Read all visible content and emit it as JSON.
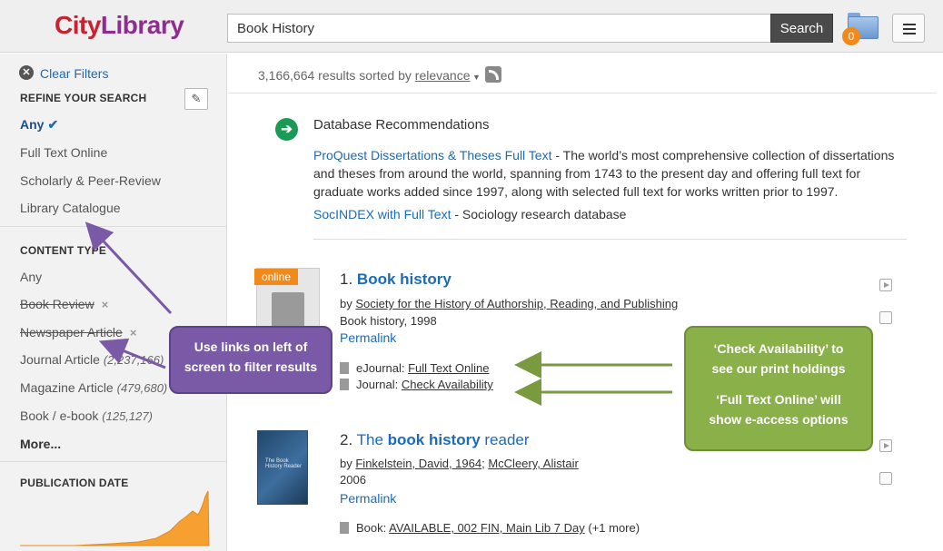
{
  "header": {
    "logo_part1": "City",
    "logo_part2": "Library",
    "search_value": "Book History",
    "search_button": "Search",
    "folder_count": "0"
  },
  "sidebar": {
    "clear_filters": "Clear Filters",
    "refine_heading": "REFINE YOUR SEARCH",
    "refine_items": [
      "Any",
      "Full Text Online",
      "Scholarly & Peer-Review",
      "Library Catalogue"
    ],
    "content_type_heading": "CONTENT TYPE",
    "content_items": [
      {
        "label": "Any",
        "count": ""
      },
      {
        "label": "Book Review",
        "count": ""
      },
      {
        "label": "Newspaper Article",
        "count": ""
      },
      {
        "label": "Journal Article",
        "count": "(2,237,166)"
      },
      {
        "label": "Magazine Article",
        "count": "(479,680)"
      },
      {
        "label": "Book / e-book",
        "count": "(125,127)"
      }
    ],
    "more_label": "More...",
    "publication_date_heading": "PUBLICATION DATE"
  },
  "results": {
    "count_text": "3,166,664 results sorted by",
    "sort_value": "relevance",
    "recommendations": {
      "title": "Database Recommendations",
      "items": [
        {
          "link": "ProQuest Dissertations & Theses Full Text",
          "description": " - The world’s most comprehensive collection of dissertations and theses from around the world, spanning from 1743 to the present day and offering full text for graduate works added since 1997, along with selected full text for works written prior to 1997."
        },
        {
          "link": "SocINDEX with Full Text",
          "description": " - Sociology research database"
        }
      ]
    },
    "items": [
      {
        "number": "1.",
        "title": "Book history",
        "thumb_badge": "online",
        "by_label": "by",
        "author": "Society for the History of Authorship, Reading, and Publishing",
        "publication": "Book history, 1998",
        "permalink": "Permalink",
        "availability": [
          {
            "label": "eJournal:",
            "value": "Full Text Online"
          },
          {
            "label": "Journal:",
            "value": "Check Availability"
          }
        ]
      },
      {
        "number": "2.",
        "title_prefix": "The",
        "title_bold": "book history",
        "title_suffix": "reader",
        "by_label": "by",
        "author1": "Finkelstein, David, 1964",
        "author2": "McCleery, Alistair",
        "year": "2006",
        "permalink": "Permalink",
        "availability_label": "Book:",
        "availability_value": "AVAILABLE, 002 FIN, Main Lib 7 Day",
        "availability_more": "(+1 more)"
      }
    ]
  },
  "callouts": {
    "left_line1": "Use links on left of",
    "left_line2": "screen to filter results",
    "right_line1": "‘Check Availability’ to",
    "right_line2": "see our print holdings",
    "right_line3": "‘Full Text Online’ will",
    "right_line4": "show e-access options"
  },
  "colors": {
    "link": "#1a6bb8",
    "logo_red": "#c8212f",
    "logo_purple": "#8e2d8f",
    "online_badge": "#f08a1c",
    "callout_purple": "#7a5aa6",
    "callout_green": "#8ab04a",
    "chart_orange": "#f5a030"
  }
}
